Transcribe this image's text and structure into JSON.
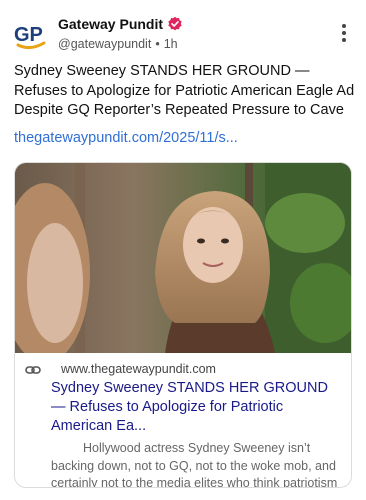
{
  "post": {
    "author_name": "Gateway Pundit",
    "handle": "@gatewaypundit",
    "separator": "•",
    "time": "1h",
    "logo_text": "GP",
    "text": "Sydney Sweeney STANDS HER GROUND — Refuses to Apologize for Patriotic American Eagle Ad Despite GQ Reporter’s Repeated Pressure to Cave",
    "link": "thegatewaypundit.com/2025/11/s..."
  },
  "card": {
    "domain": "www.thegatewaypundit.com",
    "title": "Sydney Sweeney STANDS HER GROUND — Refuses to Apologize for Patriotic American Ea...",
    "description": "Hollywood actress Sydney Sweeney isn’t backing down, not to GQ, not to the woke mob, and certainly not to the media elites who think patriotism and blonde hair are somehow offensive."
  },
  "colors": {
    "link": "#2f6fd6",
    "verified_badge": "#e0245e",
    "logo_blue": "#1d3f7a",
    "logo_gold": "#e8a317"
  },
  "icons": {
    "more": "more-vertical-icon",
    "link": "link-icon",
    "verified": "verified-badge-icon"
  }
}
